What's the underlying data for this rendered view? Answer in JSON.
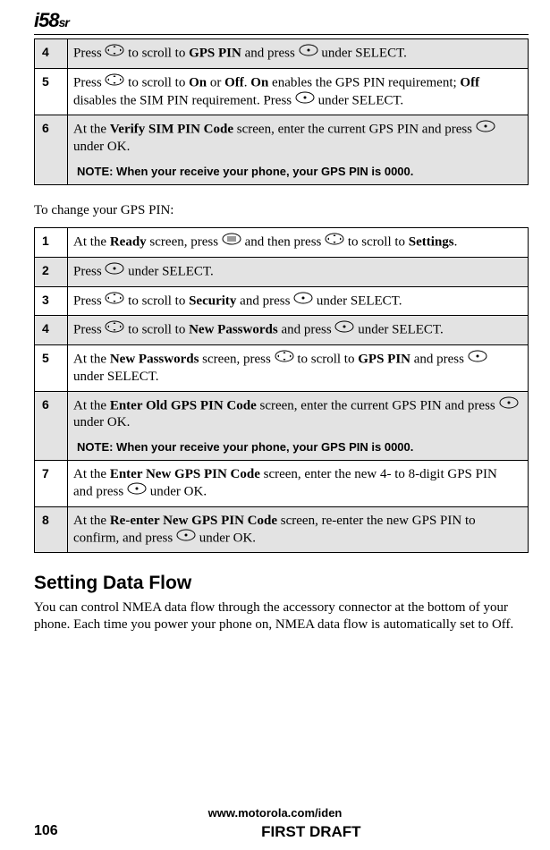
{
  "logo": {
    "main": "i58",
    "suffix": "sr"
  },
  "table1": {
    "rows": [
      {
        "num": "4",
        "bold_a": "GPS PIN",
        "pre": "Press ",
        "mid": " to scroll to ",
        "post_a": " and press ",
        "post_b": " under SELECT."
      },
      {
        "num": "5",
        "pre": "Press ",
        "mid": " to scroll to ",
        "bold_on": "On",
        "or": " or ",
        "bold_off": "Off",
        "dot": ". ",
        "bold_on2": "On",
        "sent2": " enables the GPS PIN requirement; ",
        "bold_off2": "Off",
        "sent3": " disables the SIM PIN requirement. Press ",
        "post_b": " under SELECT."
      },
      {
        "num": "6",
        "pre": "At the ",
        "bold_a": "Verify SIM PIN Code",
        "mid": " screen, enter the current GPS PIN and press ",
        "post_b": " under OK.",
        "note": "NOTE: When your receive your phone, your GPS PIN is 0000."
      }
    ]
  },
  "intro1": "To change your GPS PIN:",
  "table2": {
    "rows": [
      {
        "num": "1",
        "pre": "At the ",
        "bold_a": "Ready",
        "mid": " screen, press ",
        "mid2": " and then press ",
        "mid3": " to scroll to ",
        "bold_b": "Settings",
        "post": "."
      },
      {
        "num": "2",
        "pre": "Press ",
        "post_b": " under SELECT."
      },
      {
        "num": "3",
        "pre": "Press ",
        "mid": " to scroll to ",
        "bold_a": "Security",
        "post_a": " and press ",
        "post_b": " under SELECT."
      },
      {
        "num": "4",
        "pre": "Press ",
        "mid": " to scroll to ",
        "bold_a": "New Passwords",
        "post_a": " and press ",
        "post_b": " under SELECT."
      },
      {
        "num": "5",
        "pre": "At the ",
        "bold_a": "New Passwords",
        "mid": " screen, press ",
        "mid2": " to scroll to ",
        "bold_b": "GPS PIN",
        "post_a": " and press ",
        "post_b": " under SELECT."
      },
      {
        "num": "6",
        "pre": "At the ",
        "bold_a": "Enter Old GPS PIN Code",
        "mid": " screen, enter the current GPS PIN and press ",
        "post_b": " under OK.",
        "note": "NOTE: When your receive your phone, your GPS PIN is 0000."
      },
      {
        "num": "7",
        "pre": "At the ",
        "bold_a": "Enter New GPS PIN Code",
        "mid": " screen, enter the new 4- to 8-digit GPS PIN and press ",
        "post_b": " under OK."
      },
      {
        "num": "8",
        "pre": "At the ",
        "bold_a": "Re-enter New GPS PIN Code",
        "mid": " screen, re-enter the new GPS PIN to confirm, and press ",
        "post_b": " under OK."
      }
    ]
  },
  "section_heading": "Setting Data Flow",
  "section_para": "You can control NMEA data flow through the accessory connector at the bottom of your phone. Each time you power your phone on, NMEA data flow is automatically set to Off.",
  "footer": {
    "url": "www.motorola.com/iden",
    "page": "106",
    "draft": "FIRST DRAFT"
  }
}
